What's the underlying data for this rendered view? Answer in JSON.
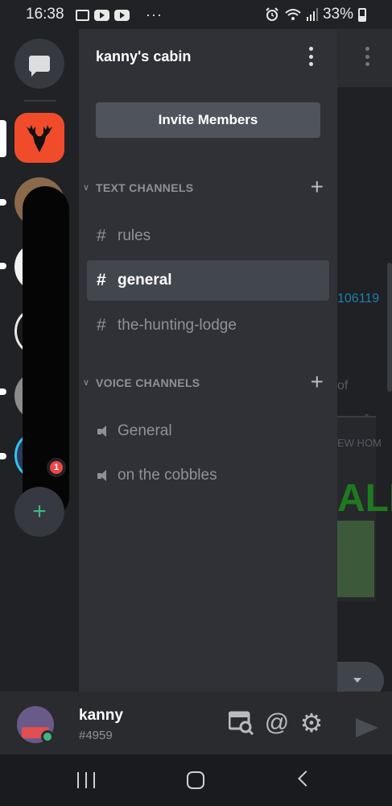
{
  "status_bar": {
    "time": "16:38",
    "battery": "33%",
    "overflow": "···",
    "icons": [
      "gallery-icon",
      "youtube-icon",
      "youtube-icon",
      "alarm-icon",
      "wifi-icon",
      "signal-icon",
      "battery-icon"
    ]
  },
  "guild_rail": {
    "dm_icon": "chat-bubble-icon",
    "active_guild": "deer-antlers-logo",
    "mention_count": "1",
    "add_server_icon": "+"
  },
  "channel_panel": {
    "guild_name": "kanny's cabin",
    "invite_label": "Invite Members",
    "categories": [
      {
        "label": "TEXT CHANNELS",
        "add_icon": "+",
        "channels": [
          {
            "prefix": "#",
            "name": "rules",
            "selected": false
          },
          {
            "prefix": "#",
            "name": "general",
            "selected": true
          },
          {
            "prefix": "#",
            "name": "the-hunting-lodge",
            "selected": false
          }
        ]
      },
      {
        "label": "VOICE CHANNELS",
        "add_icon": "+",
        "channels": [
          {
            "prefix": "speaker-icon",
            "name": "General"
          },
          {
            "prefix": "speaker-icon",
            "name": "on the cobbles"
          }
        ]
      }
    ]
  },
  "chat_peek": {
    "link_fragment": "106119",
    "text_fragment": "of",
    "dash_fragment": "-",
    "embed_header_fragment": "EW HOM",
    "embed_big_fragment": "ALE"
  },
  "user_bar": {
    "username": "kanny",
    "tag": "#4959",
    "at_icon": "@",
    "gear_icon": "⚙"
  },
  "colors": {
    "rail_bg": "#202225",
    "panel_bg": "#2f3136",
    "selected_bg": "#42464d",
    "online": "#43b581",
    "accent_red": "#f04c2c",
    "mention": "#f04747"
  }
}
